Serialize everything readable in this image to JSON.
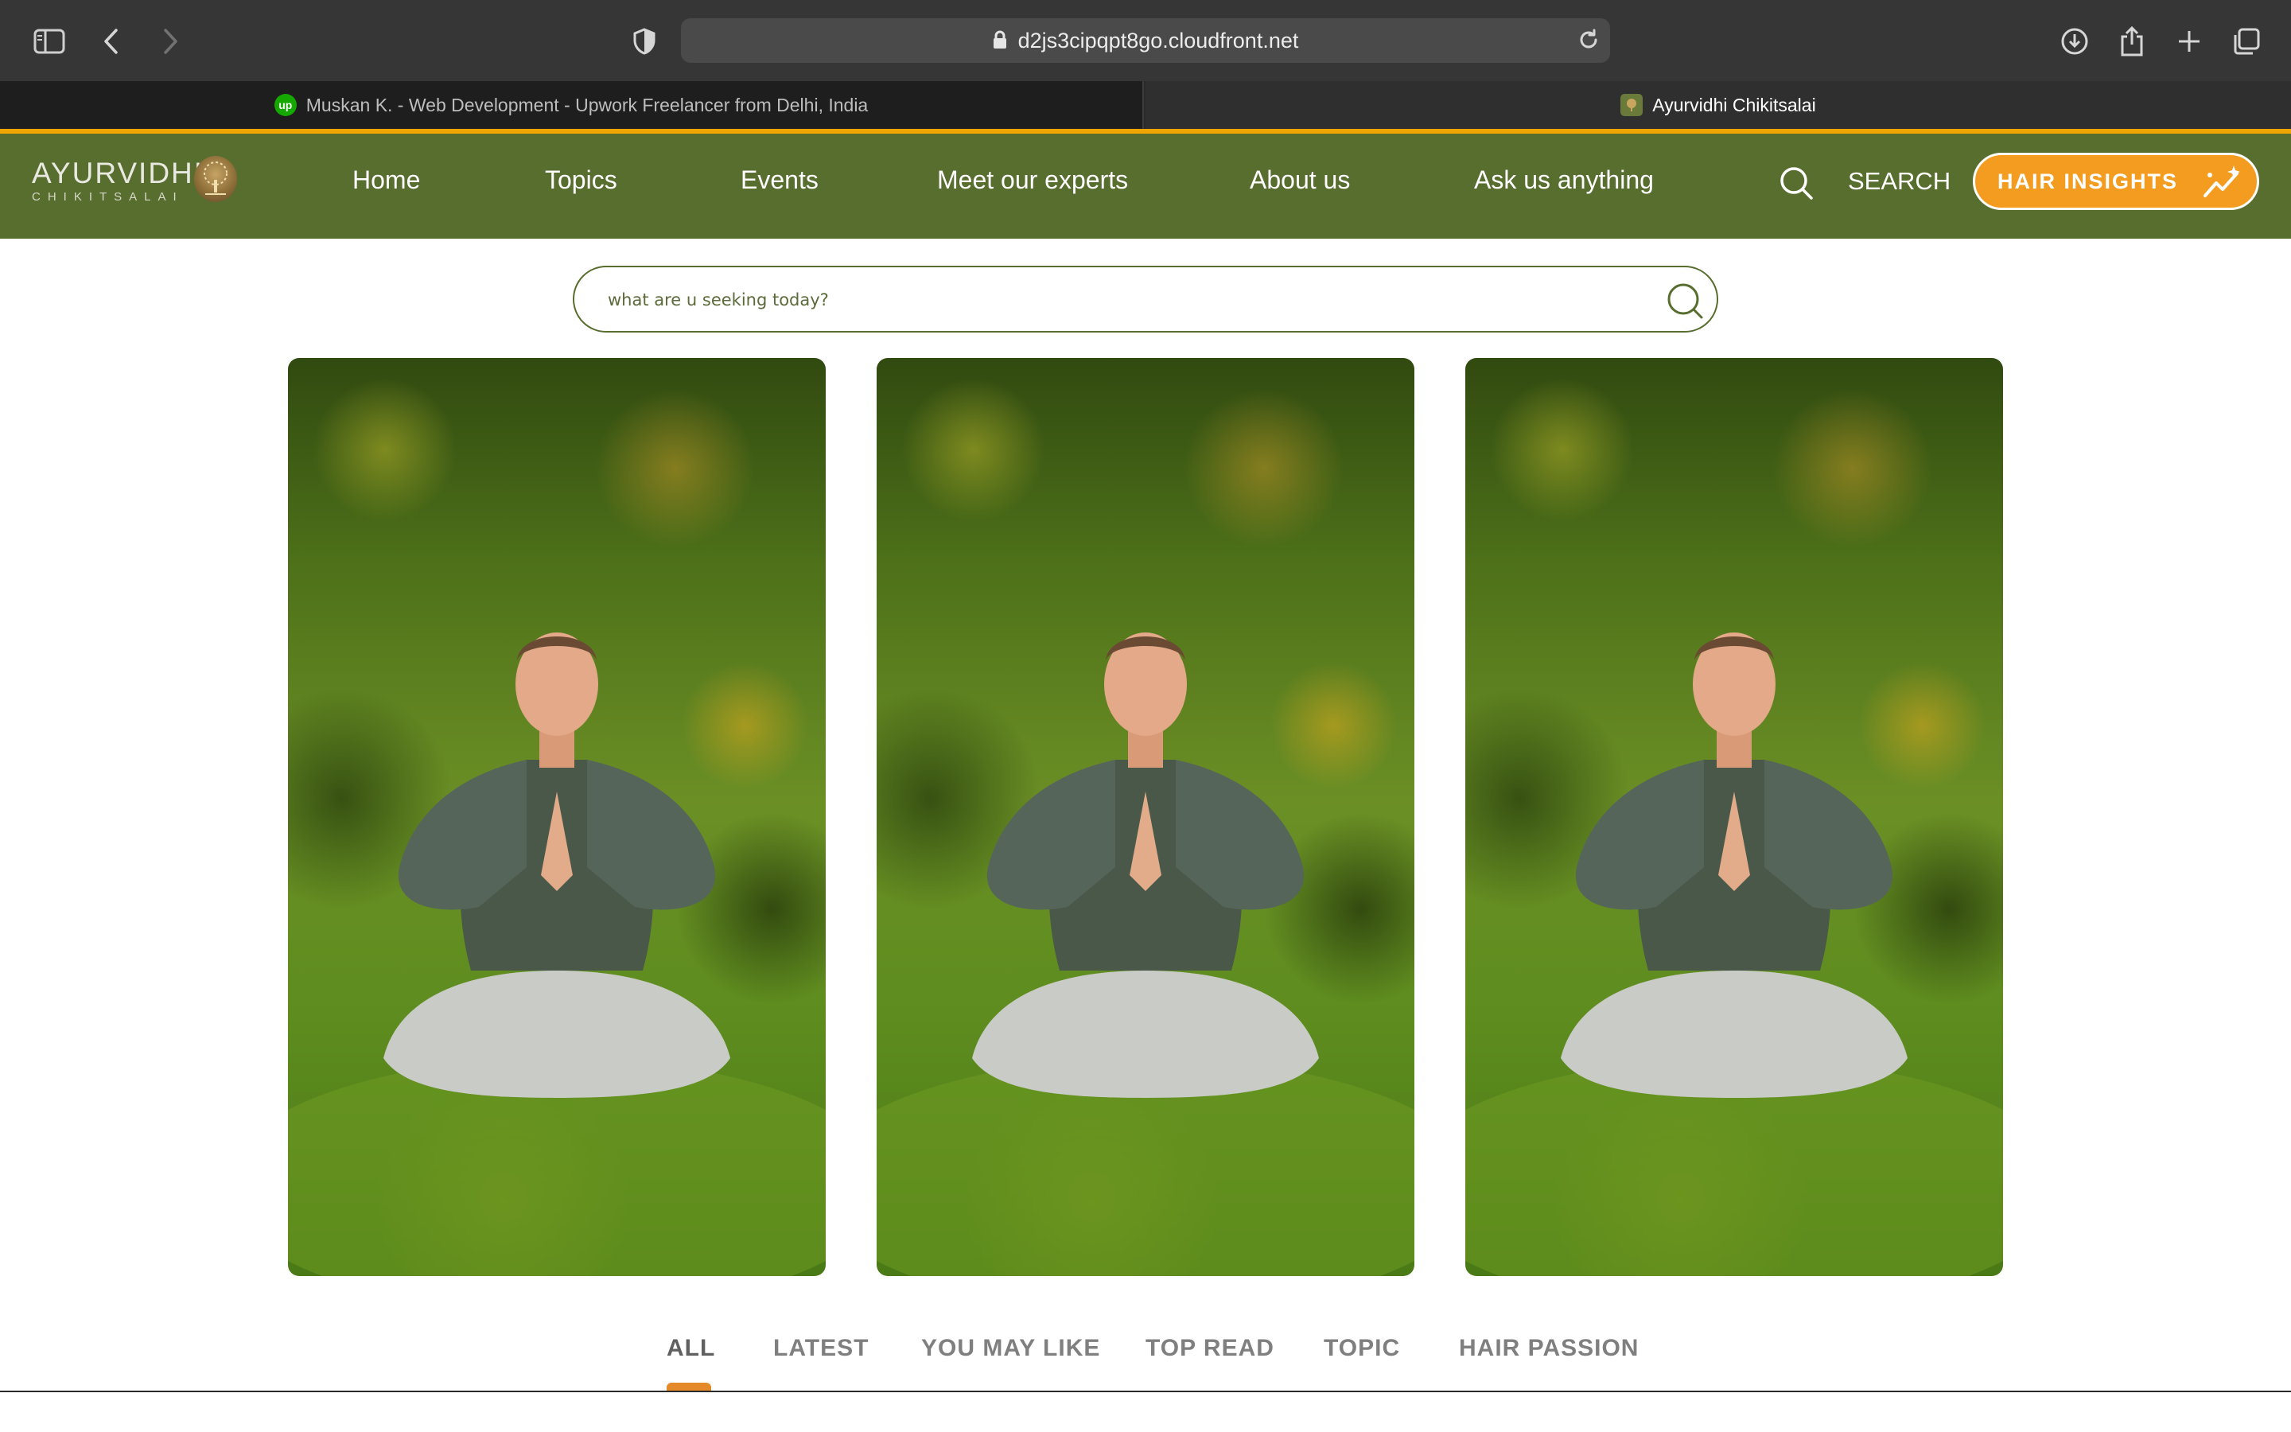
{
  "browser": {
    "url": "d2js3cipqpt8go.cloudfront.net",
    "tabs": [
      {
        "title": "Muskan K. - Web Development - Upwork Freelancer from Delhi, India",
        "favicon_text": "up",
        "active": false
      },
      {
        "title": "Ayurvidhi Chikitsalai",
        "favicon_text": "",
        "active": true
      }
    ]
  },
  "site": {
    "logo": {
      "main": "AYURVIDHI",
      "sub": "CHIKITSALAI"
    },
    "nav": [
      {
        "label": "Home"
      },
      {
        "label": "Topics"
      },
      {
        "label": "Events"
      },
      {
        "label": "Meet our experts"
      },
      {
        "label": "About us"
      },
      {
        "label": "Ask us anything"
      }
    ],
    "search_label": "SEARCH",
    "cta_label": "HAIR INSIGHTS",
    "colors": {
      "nav_bg": "#586e2e",
      "accent": "#f39c1f",
      "indicator": "#e58a2b"
    }
  },
  "search": {
    "placeholder": "what are u seeking today?"
  },
  "filters": [
    {
      "label": "ALL",
      "active": true
    },
    {
      "label": "LATEST",
      "active": false
    },
    {
      "label": "YOU MAY LIKE",
      "active": false
    },
    {
      "label": "TOP READ",
      "active": false
    },
    {
      "label": "TOPIC",
      "active": false
    },
    {
      "label": "HAIR PASSION",
      "active": false
    }
  ]
}
